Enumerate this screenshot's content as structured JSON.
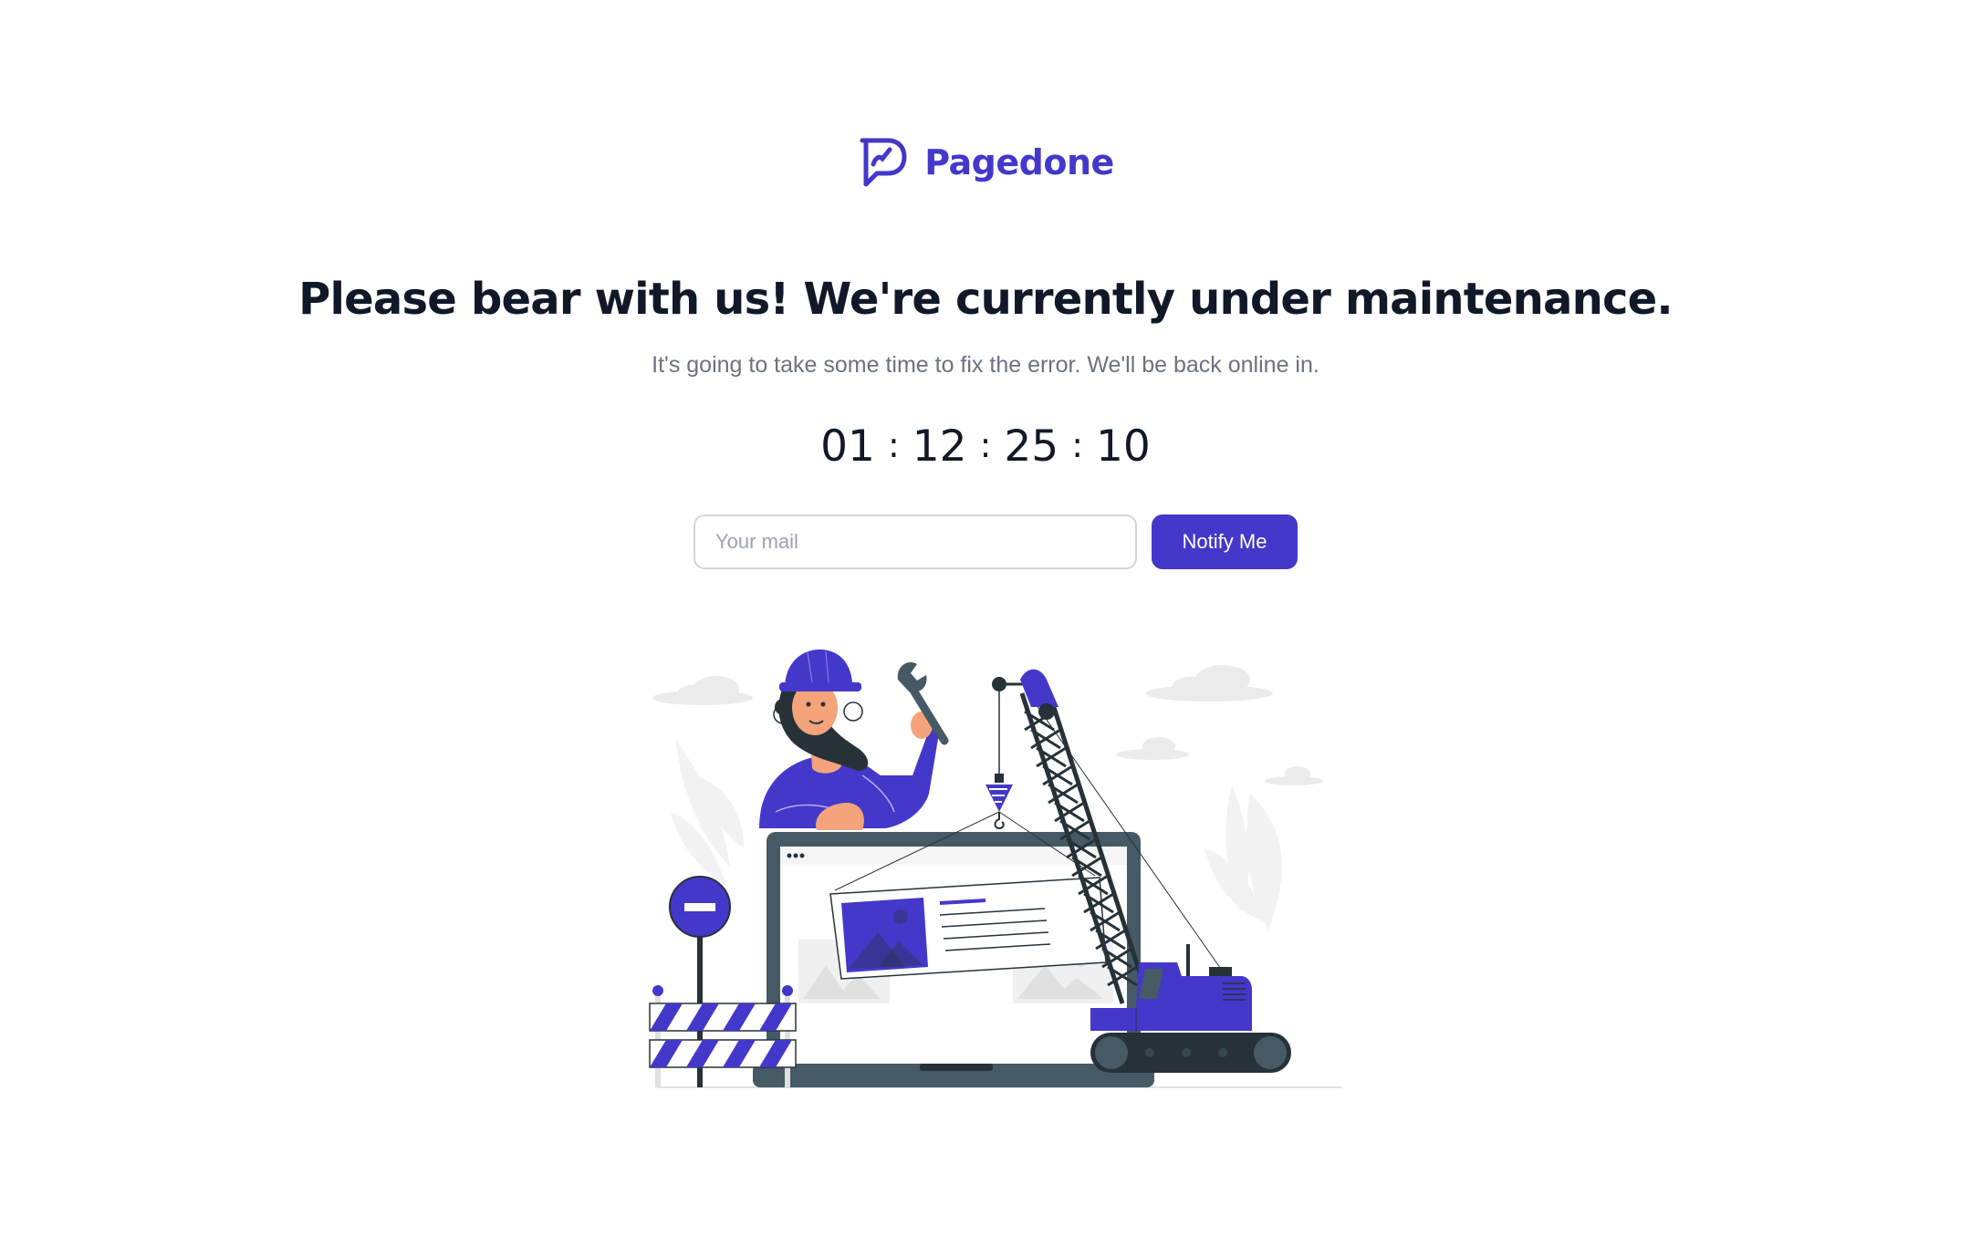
{
  "brand": {
    "name": "Pagedone",
    "icon": "pagedone-logo-icon",
    "color": "#4338ca"
  },
  "headline": "Please bear with us! We're currently under maintenance.",
  "subtext": "It's going to take some time to fix the error. We'll be back online in.",
  "countdown": {
    "days": "01",
    "hours": "12",
    "minutes": "25",
    "seconds": "10",
    "separator": ":"
  },
  "notify": {
    "placeholder": "Your mail",
    "value": "",
    "button_label": "Notify Me"
  },
  "illustration": {
    "icon": "maintenance-illustration",
    "accent_color": "#4338ca",
    "dark_color": "#263238",
    "light_color": "#ebebeb"
  }
}
